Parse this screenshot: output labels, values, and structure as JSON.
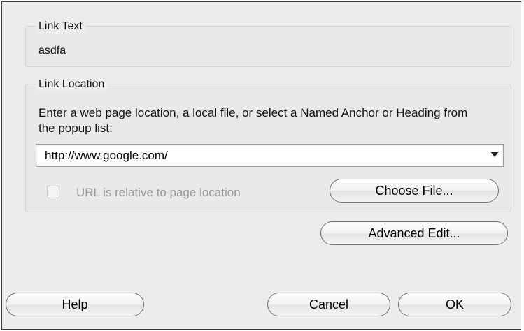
{
  "dialog": {
    "link_text": {
      "title": "Link Text",
      "value": "asdfa"
    },
    "link_location": {
      "title": "Link Location",
      "instructions": "Enter a web page location, a local file, or select a Named Anchor or Heading from the popup list:",
      "url_value": "http://www.google.com/",
      "relative_checkbox_label": "URL is relative to page location",
      "relative_checked": false,
      "choose_file_label": "Choose File..."
    },
    "advanced_edit_label": "Advanced Edit...",
    "buttons": {
      "help": "Help",
      "cancel": "Cancel",
      "ok": "OK"
    }
  }
}
